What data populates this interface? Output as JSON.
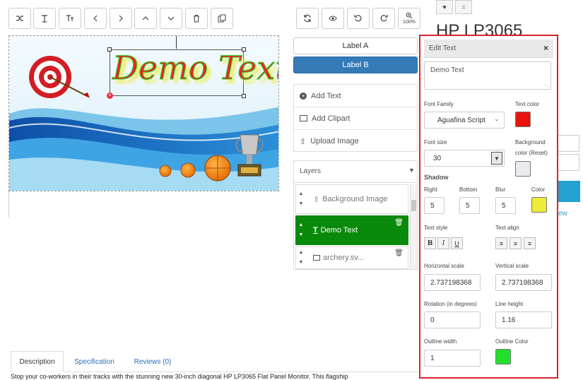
{
  "toolbar": {
    "buttons": [
      "shuffle-icon",
      "text-icon",
      "text-size-icon",
      "chevron-left-icon",
      "chevron-right-icon",
      "chevron-up-icon",
      "chevron-down-icon",
      "trash-icon",
      "copy-icon"
    ],
    "right_buttons": [
      "refresh-icon",
      "eye-icon",
      "undo-icon",
      "redo-icon",
      "zoom-icon"
    ],
    "zoom_label": "100%"
  },
  "canvas": {
    "demo_text": "Demo Text"
  },
  "product_title": "HP LP3065",
  "label_a": "Label A",
  "label_b": "Label B",
  "menu": {
    "add_text": "Add Text",
    "add_clipart": "Add Clipart",
    "upload_image": "Upload Image"
  },
  "layers": {
    "title": "Layers",
    "items": [
      "Background Image",
      "Demo Text",
      "archery.sv..."
    ]
  },
  "edit_text": {
    "title": "Edit Text",
    "text_value": "Demo Text",
    "font_family_label": "Font Family",
    "font_family_value": "Aguafina Script",
    "text_color_label": "Text color",
    "text_color": "#e8130c",
    "font_size_label": "Font size",
    "font_size_value": "30",
    "background_label": "Background",
    "background_reset_label": "color (Reset)",
    "background_color": "#eceaf0",
    "shadow_label": "Shadow",
    "right_label": "Right",
    "right_value": "5",
    "bottom_label": "Bottom",
    "bottom_value": "5",
    "blur_label": "Blur",
    "blur_value": "5",
    "shadow_color_label": "Color",
    "shadow_color": "#ecec3a",
    "text_style_label": "Text style",
    "text_align_label": "Text align",
    "hscale_label": "Horizontal scale",
    "hscale_value": "2.737198368",
    "vscale_label": "Vertical scale",
    "vscale_value": "2.737198368",
    "rotation_label": "Rotation (in degrees)",
    "rotation_value": "0",
    "line_height_label": "Line height",
    "line_height_value": "1.16",
    "outline_width_label": "Outline width",
    "outline_width_value": "1",
    "outline_color_label": "Outline Color",
    "outline_color": "#22e02a"
  },
  "tabs": {
    "description": "Description",
    "specification": "Specification",
    "reviews": "Reviews (0)"
  },
  "description_text": "Stop your co-workers in their tracks with the stunning new 30-inch diagonal HP LP3065 Flat Panel Monitor. This flagship",
  "partial_link": "ew"
}
